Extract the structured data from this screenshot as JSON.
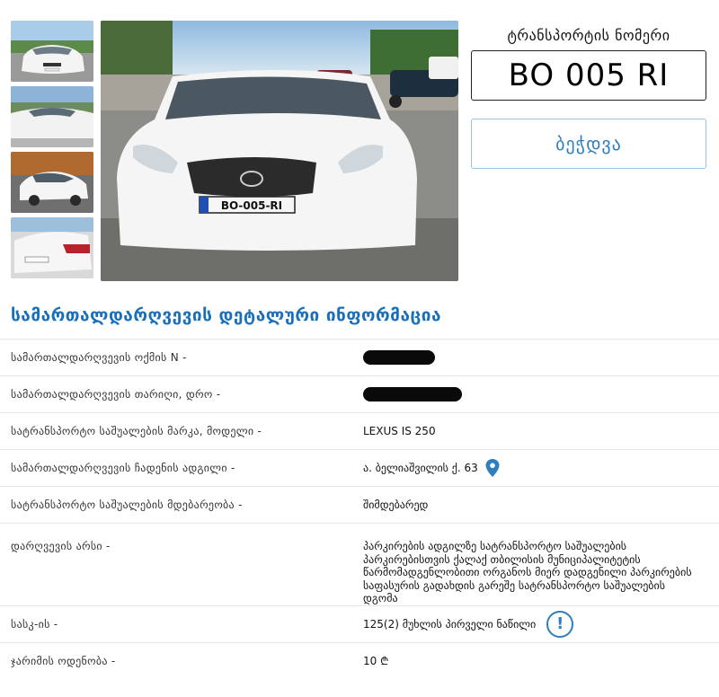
{
  "gallery": {
    "thumbnails": [
      {
        "name": "car-front-thumbnail"
      },
      {
        "name": "car-hood-thumbnail"
      },
      {
        "name": "car-side-thumbnail"
      },
      {
        "name": "car-rear-thumbnail"
      }
    ],
    "main_photo_plate": "BO-005-RI"
  },
  "plate_panel": {
    "title": "ტრანსპორტის ნომერი",
    "plate_number": "BO 005 RI",
    "print_label": "ბეჭდვა"
  },
  "details": {
    "section_title": "სამართალდარღვევის დეტალური ინფორმაცია",
    "rows": [
      {
        "label": "სამართალდარღვევის ოქმის N -",
        "value": ""
      },
      {
        "label": "სამართალდარღვევის თარიღი, დრო -",
        "value": ""
      },
      {
        "label": "სატრანსპორტო საშუალების მარკა, მოდელი -",
        "value": "LEXUS IS 250"
      },
      {
        "label": "სამართალდარღვევის ჩადენის ადგილი -",
        "value": "ა. ბელიაშვილის ქ. 63"
      },
      {
        "label": "სატრანსპორტო საშუალების მდებარეობა -",
        "value": "შიმდებარედ"
      },
      {
        "label": "დარღვევის არსი -",
        "value": "პარკირების ადგილზე სატრანსპორტო საშუალების პარკირებისთვის ქალაქ თბილისის მუნიციპალიტეტის წარმომადგენლობითი ორგანოს მიერ დადგენილი პარკირების საფასურის გადახდის გარეშე სატრანსპორტო საშუალების დგომა"
      },
      {
        "label": "სასკ-ის -",
        "value": "125(2) მუხლის პირველი ნაწილი"
      },
      {
        "label": "ჯარიმის ოდენობა -",
        "value": "10 ₾"
      }
    ]
  },
  "icons": {
    "location": "map-pin-icon",
    "info": "exclamation-info-icon"
  },
  "colors": {
    "accent": "#2d7fc1",
    "title": "#1a6fba",
    "redaction": "#0a0a0a"
  }
}
